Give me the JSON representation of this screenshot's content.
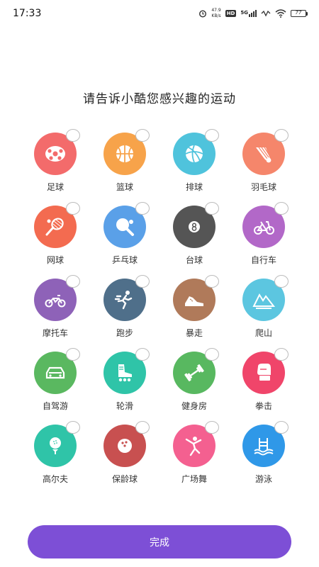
{
  "status_bar": {
    "time": "17:33",
    "net_speed_value": "47.9",
    "net_speed_unit": "KB/s",
    "hd_badge": "HD",
    "signal_label": "5G",
    "battery": "77"
  },
  "title": "请告诉小酷您感兴趣的运动",
  "sports": [
    {
      "label": "足球",
      "color": "#f36b6b",
      "icon": "soccer-ball-icon"
    },
    {
      "label": "篮球",
      "color": "#f7a34a",
      "icon": "basketball-icon"
    },
    {
      "label": "排球",
      "color": "#4fc3dc",
      "icon": "volleyball-icon"
    },
    {
      "label": "羽毛球",
      "color": "#f5866b",
      "icon": "shuttlecock-icon"
    },
    {
      "label": "网球",
      "color": "#f36b50",
      "icon": "tennis-racket-icon"
    },
    {
      "label": "乒乓球",
      "color": "#5aa0e8",
      "icon": "ping-pong-paddle-icon"
    },
    {
      "label": "台球",
      "color": "#555555",
      "icon": "billiard-8-ball-icon"
    },
    {
      "label": "自行车",
      "color": "#b268c8",
      "icon": "bicycle-icon"
    },
    {
      "label": "摩托车",
      "color": "#8e62b8",
      "icon": "motorcycle-icon"
    },
    {
      "label": "跑步",
      "color": "#4f6f8a",
      "icon": "runner-icon"
    },
    {
      "label": "暴走",
      "color": "#b07a5a",
      "icon": "sneaker-icon"
    },
    {
      "label": "爬山",
      "color": "#5cc6e0",
      "icon": "mountain-icon"
    },
    {
      "label": "自驾游",
      "color": "#5ab860",
      "icon": "car-icon"
    },
    {
      "label": "轮滑",
      "color": "#2fc4a8",
      "icon": "roller-skate-icon"
    },
    {
      "label": "健身房",
      "color": "#58b860",
      "icon": "dumbbell-icon"
    },
    {
      "label": "拳击",
      "color": "#f0456a",
      "icon": "boxing-glove-icon"
    },
    {
      "label": "高尔夫",
      "color": "#2fc4a8",
      "icon": "golf-ball-icon"
    },
    {
      "label": "保龄球",
      "color": "#c85050",
      "icon": "bowling-ball-icon"
    },
    {
      "label": "广场舞",
      "color": "#f46090",
      "icon": "dancer-icon"
    },
    {
      "label": "游泳",
      "color": "#2f98e8",
      "icon": "swimming-pool-icon"
    }
  ],
  "done_button": "完成"
}
